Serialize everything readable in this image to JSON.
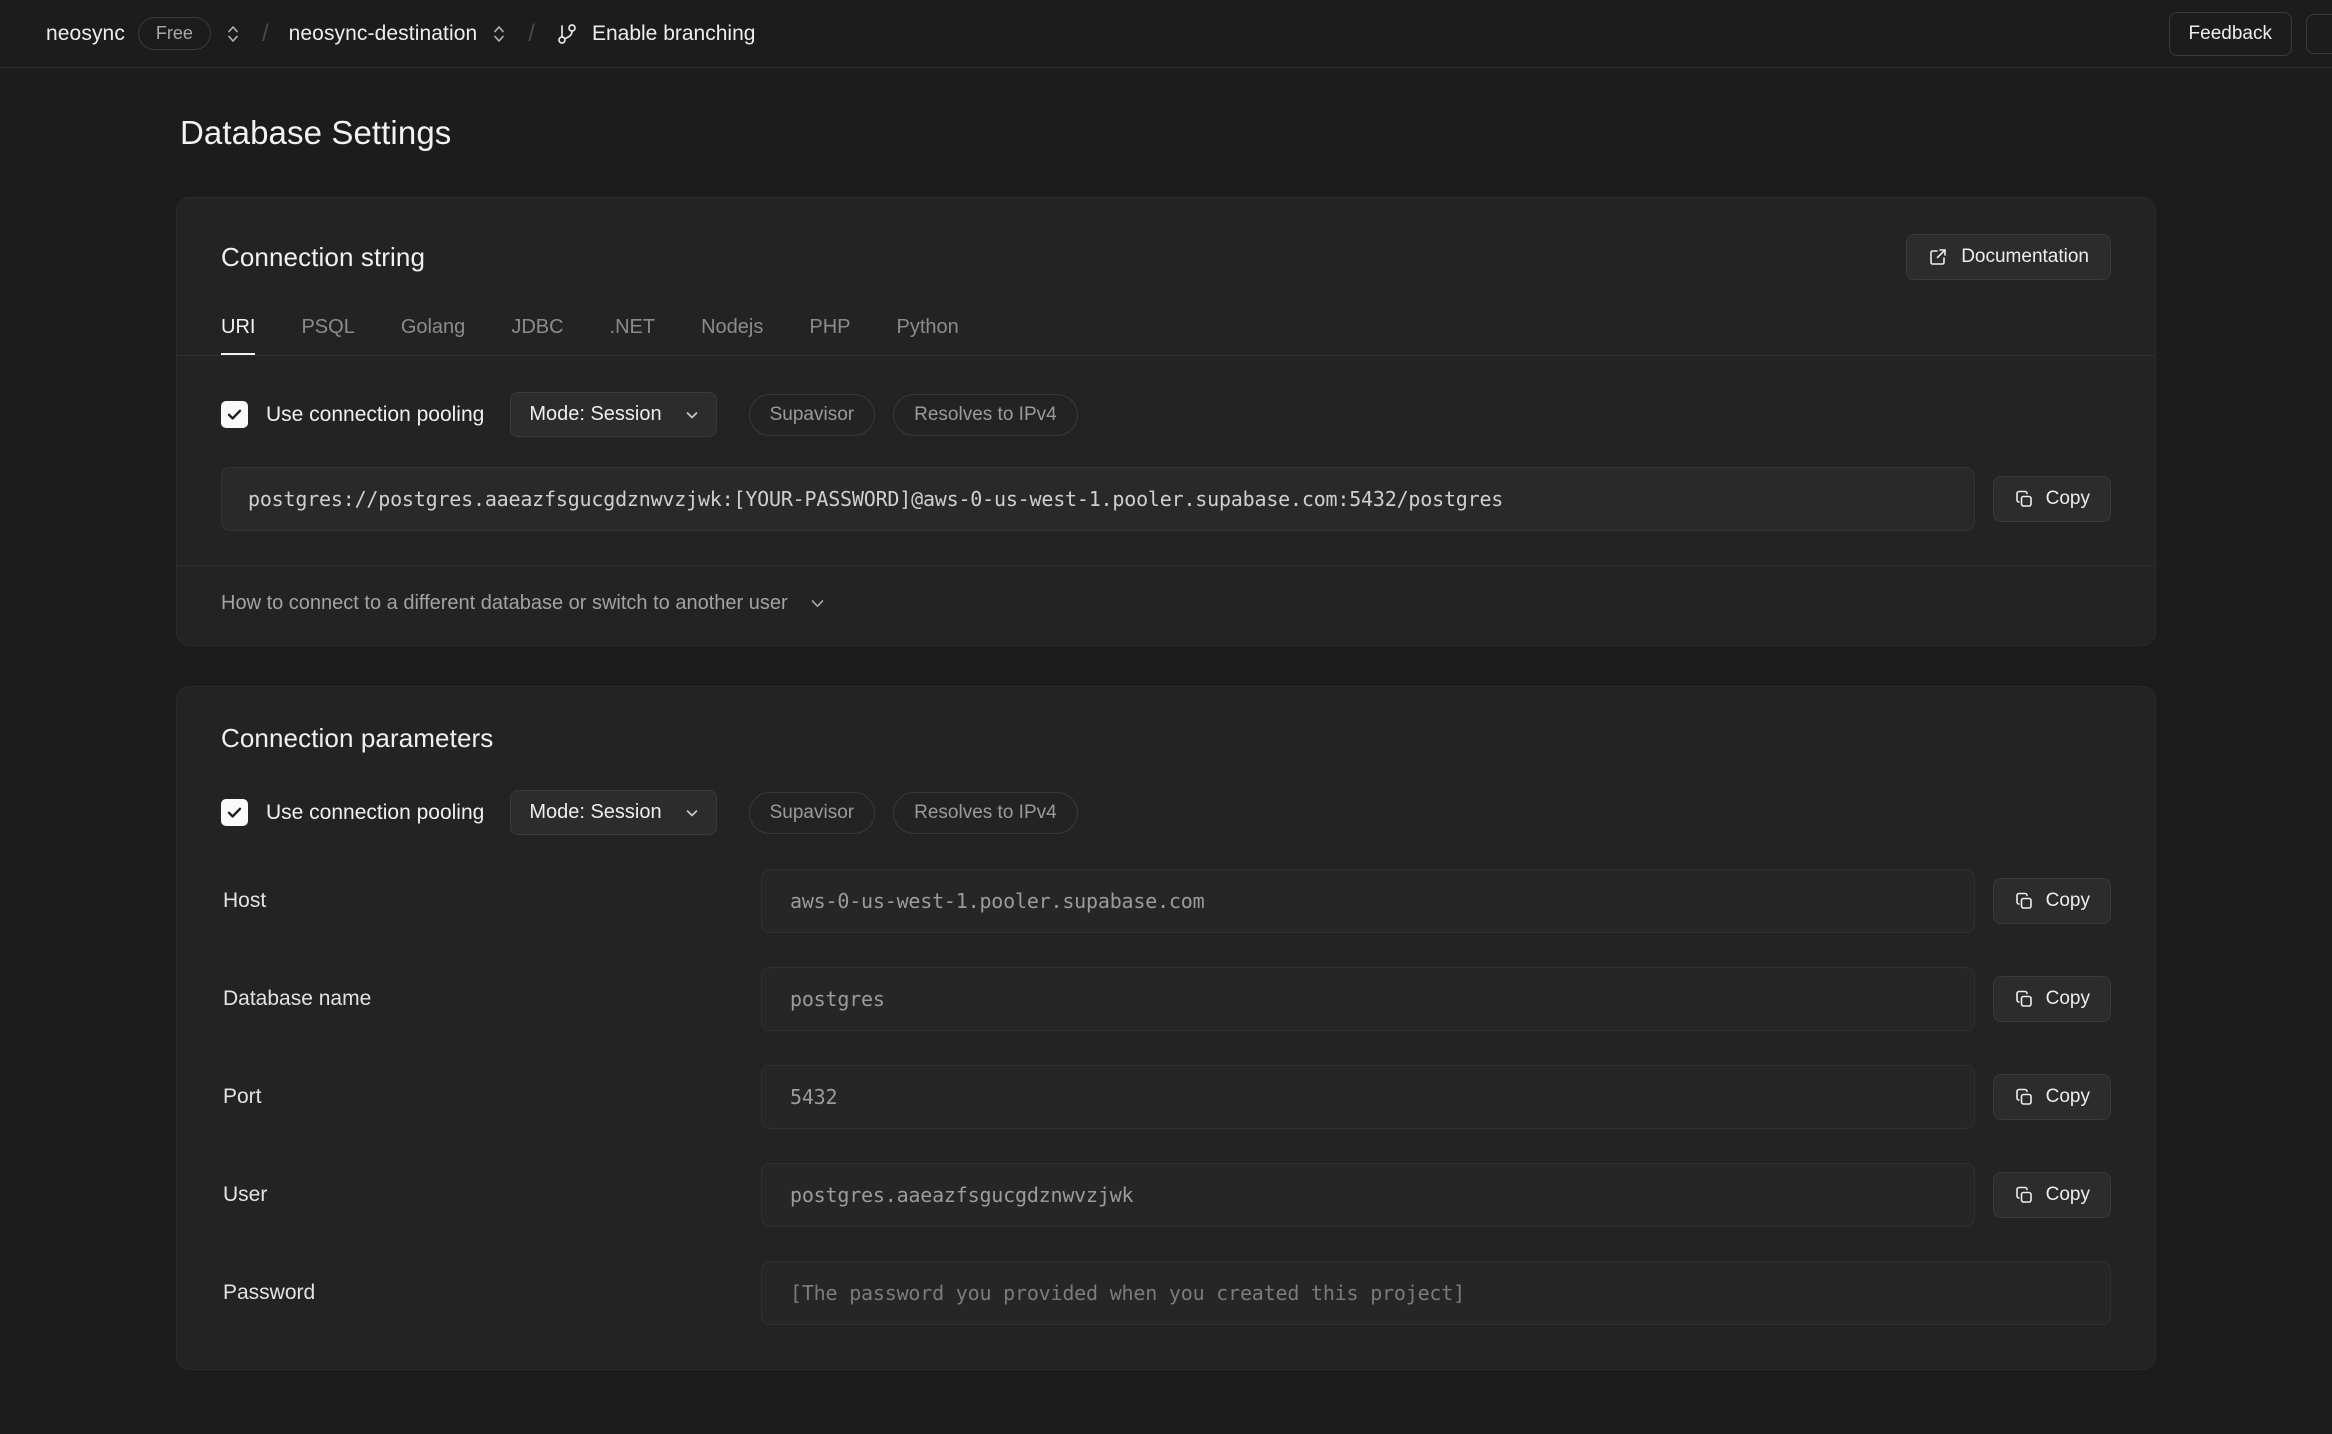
{
  "topbar": {
    "org": "neosync",
    "plan_badge": "Free",
    "project": "neosync-destination",
    "branching_label": "Enable branching",
    "feedback_label": "Feedback",
    "icons": {
      "org_switcher": "chevron-up-down-icon",
      "project_switcher": "chevron-up-down-icon",
      "branching": "git-branch-icon",
      "separator": "/"
    }
  },
  "page": {
    "title": "Database Settings"
  },
  "connection_string": {
    "title": "Connection string",
    "documentation_label": "Documentation",
    "tabs": [
      {
        "label": "URI",
        "active": true
      },
      {
        "label": "PSQL",
        "active": false
      },
      {
        "label": "Golang",
        "active": false
      },
      {
        "label": "JDBC",
        "active": false
      },
      {
        "label": ".NET",
        "active": false
      },
      {
        "label": "Nodejs",
        "active": false
      },
      {
        "label": "PHP",
        "active": false
      },
      {
        "label": "Python",
        "active": false
      }
    ],
    "pooling": {
      "checked": true,
      "label": "Use connection pooling",
      "mode_label": "Mode: Session",
      "badges": [
        "Supavisor",
        "Resolves to IPv4"
      ]
    },
    "value": "postgres://postgres.aaeazfsgucgdznwvzjwk:[YOUR-PASSWORD]@aws-0-us-west-1.pooler.supabase.com:5432/postgres",
    "copy_label": "Copy",
    "expand_label": "How to connect to a different database or switch to another user"
  },
  "connection_parameters": {
    "title": "Connection parameters",
    "pooling": {
      "checked": true,
      "label": "Use connection pooling",
      "mode_label": "Mode: Session",
      "badges": [
        "Supavisor",
        "Resolves to IPv4"
      ]
    },
    "copy_label": "Copy",
    "fields": [
      {
        "label": "Host",
        "value": "aws-0-us-west-1.pooler.supabase.com",
        "copy": true,
        "muted": false
      },
      {
        "label": "Database name",
        "value": "postgres",
        "copy": true,
        "muted": false
      },
      {
        "label": "Port",
        "value": "5432",
        "copy": true,
        "muted": false
      },
      {
        "label": "User",
        "value": "postgres.aaeazfsgucgdznwvzjwk",
        "copy": true,
        "muted": false
      },
      {
        "label": "Password",
        "value": "[The password you provided when you created this project]",
        "copy": false,
        "muted": true
      }
    ]
  },
  "colors": {
    "page_background": "#1c1c1c",
    "card_background": "#232323",
    "border": "#2e2e2e",
    "text_primary": "#ededed",
    "text_muted": "#8b8b8b",
    "accent": "#fafafa"
  }
}
